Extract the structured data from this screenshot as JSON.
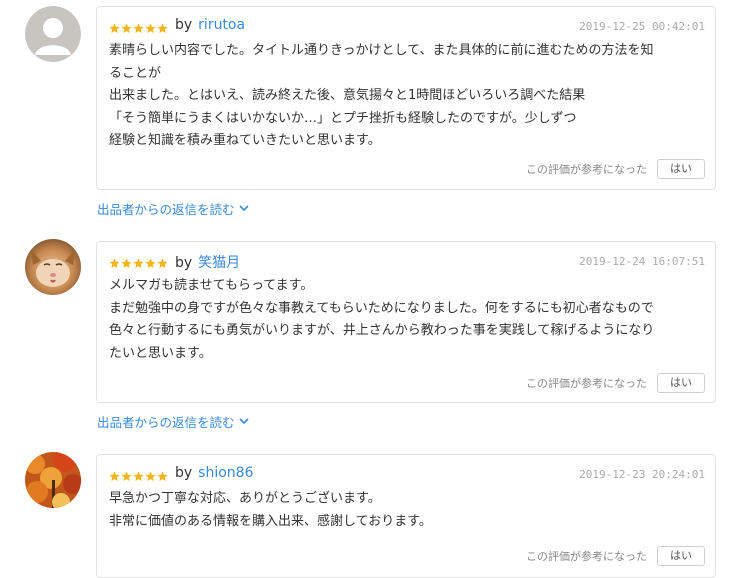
{
  "colors": {
    "star": "#f2b517",
    "link": "#3a8ad8"
  },
  "helpful_question": "この評価が参考になった",
  "helpful_button": "はい",
  "reply_link_label": "出品者からの返信を読む",
  "reviews": [
    {
      "author": "rirutoa",
      "by": "by",
      "date": "2019-12-25 00:42:01",
      "rating": 5,
      "avatar": "default-user-avatar",
      "lines": [
        "素晴らしい内容でした。タイトル通りきっかけとして、また具体的に前に進むための方法を知",
        "ることが",
        "出来ました。とはいえ、読み終えた後、意気揚々と1時間ほどいろいろ調べた結果",
        "「そう簡単にうまくはいかないか…」とプチ挫折も経験したのですが。少しずつ",
        "経験と知識を積み重ねていきたいと思います。"
      ]
    },
    {
      "author": "笑猫月",
      "by": "by",
      "date": "2019-12-24 16:07:51",
      "rating": 5,
      "avatar": "cat-photo-avatar",
      "lines": [
        "メルマガも読ませてもらってます。",
        "まだ勉強中の身ですが色々な事教えてもらいためになりました。何をするにも初心者なもので",
        "色々と行動するにも勇気がいりますが、井上さんから教わった事を実践して稼げるようになり",
        "たいと思います。"
      ]
    },
    {
      "author": "shion86",
      "by": "by",
      "date": "2019-12-23 20:24:01",
      "rating": 5,
      "avatar": "autumn-leaves-photo-avatar",
      "lines": [
        "早急かつ丁寧な対応、ありがとうございます。",
        "非常に価値のある情報を購入出来、感謝しております。"
      ]
    }
  ]
}
